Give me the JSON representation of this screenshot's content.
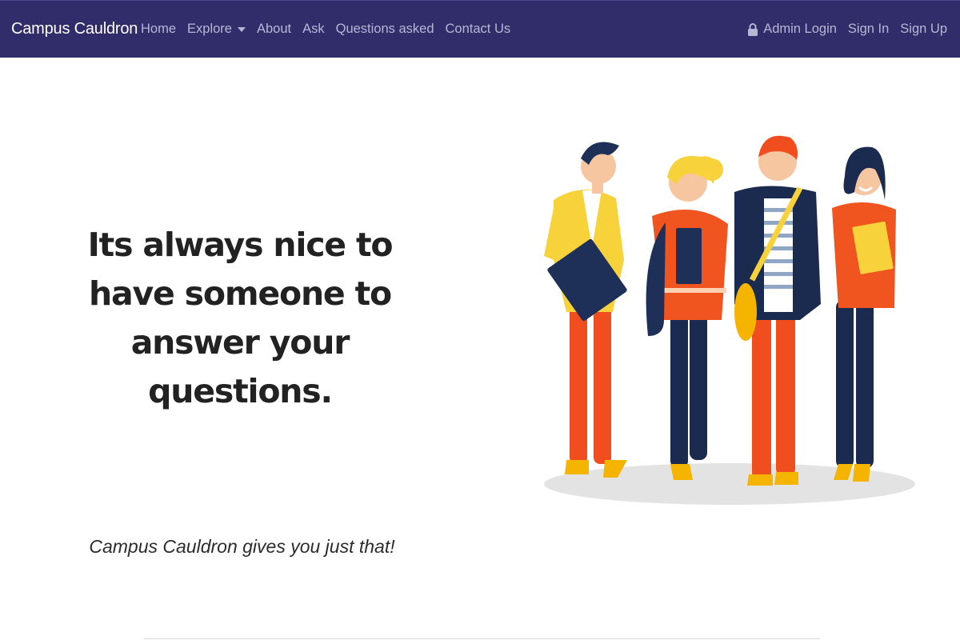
{
  "navbar": {
    "brand": "Campus Cauldron",
    "links": [
      {
        "label": "Home"
      },
      {
        "label": "Explore",
        "has_dropdown": true
      },
      {
        "label": "About"
      },
      {
        "label": "Ask"
      },
      {
        "label": "Questions asked"
      },
      {
        "label": "Contact Us"
      }
    ],
    "right_links": [
      {
        "label": "Admin Login",
        "icon": "lock-icon"
      },
      {
        "label": "Sign In"
      },
      {
        "label": "Sign Up"
      }
    ],
    "background_color": "#312d6b",
    "link_color": "#b7b6d4"
  },
  "hero": {
    "heading": "Its always nice to have someone to answer your questions.",
    "tagline": "Campus Cauldron gives you just that!"
  }
}
